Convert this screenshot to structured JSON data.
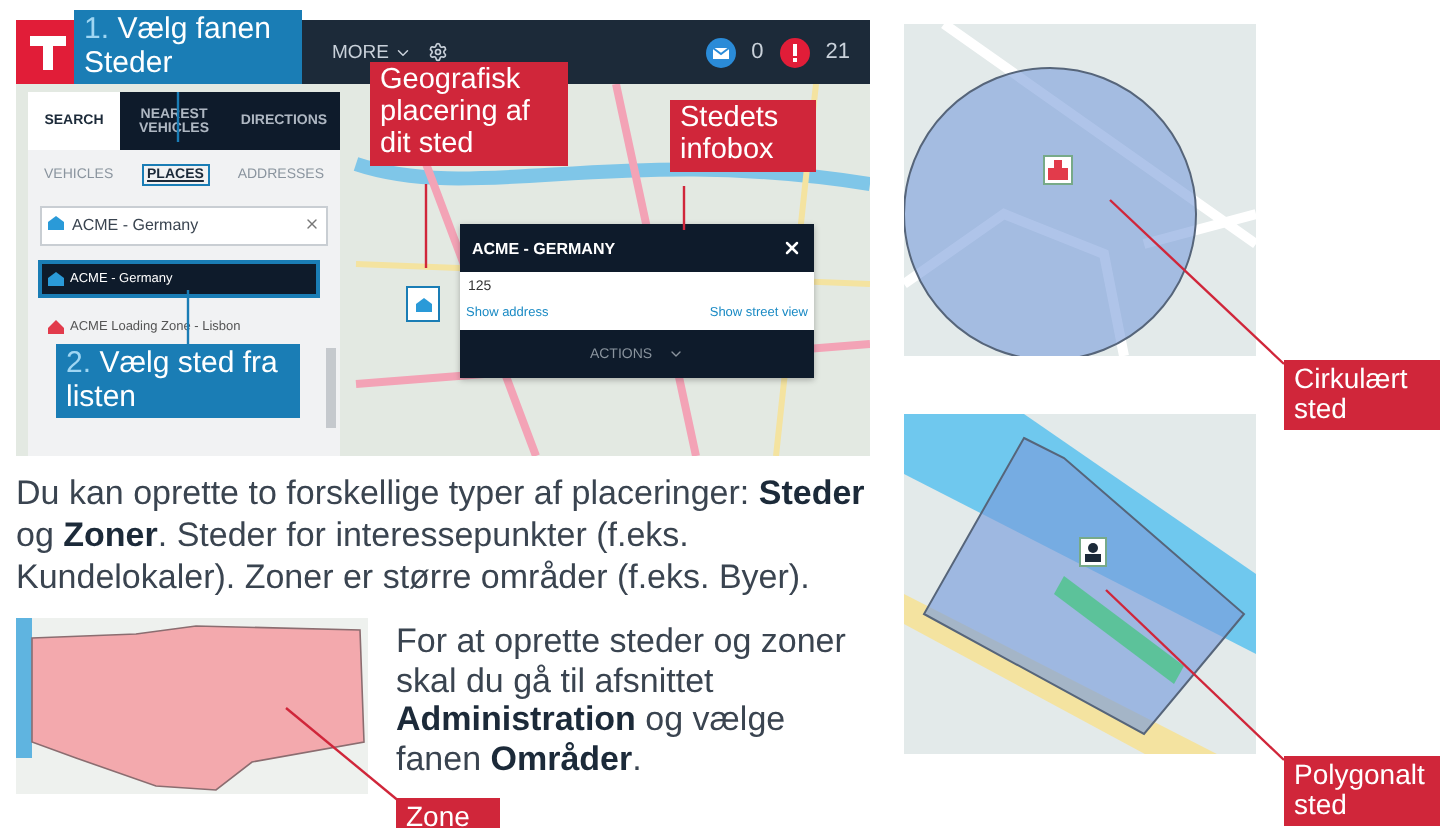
{
  "app_screenshot": {
    "topbar": {
      "menu": "MORE",
      "messages": "0",
      "alerts": "21"
    },
    "search_panel": {
      "tabs": [
        {
          "label": "SEARCH",
          "selected": true
        },
        {
          "label": "NEAREST VEHICLES",
          "selected": false
        },
        {
          "label": "DIRECTIONS",
          "selected": false
        }
      ],
      "subtabs": [
        {
          "label": "VEHICLES",
          "selected": false
        },
        {
          "label": "PLACES",
          "selected": true
        },
        {
          "label": "ADDRESSES",
          "selected": false
        }
      ],
      "search_value": "ACME - Germany",
      "results": [
        {
          "label": "ACME - Germany",
          "kind": "depot",
          "selected": true
        },
        {
          "label": "ACME Loading Zone - Lisbon",
          "kind": "loading",
          "selected": false
        }
      ]
    },
    "infobox": {
      "title": "ACME - GERMANY",
      "value": "125",
      "links": [
        "Show address",
        "Show street view"
      ],
      "actions": "ACTIONS"
    }
  },
  "callouts": [
    {
      "number": "1.",
      "text": "Vælg fanen Steder",
      "color": "#1a7db5"
    },
    {
      "number": "2.",
      "text": "Vælg sted fra listen",
      "color": "#1a7db5"
    },
    {
      "text": "Geografisk placering af dit sted",
      "color": "#d0263a"
    },
    {
      "text": "Stedets infobox",
      "color": "#d0263a"
    },
    {
      "text": "Cirkulært sted",
      "color": "#d0263a"
    },
    {
      "text": "Zone",
      "color": "#d0263a"
    },
    {
      "text": "Polygonalt sted",
      "color": "#d0263a"
    }
  ],
  "intro": "Du kan oprette to forskellige typer af placeringer: **Steder** og **Zoner**. Steder for interessepunkter (f.eks. Kundelokaler). Zoner er større områder (f.eks. Byer).",
  "instructions": "For at oprette steder og zoner skal du gå til afsnittet **Administration** og vælge fanen **Områder**."
}
